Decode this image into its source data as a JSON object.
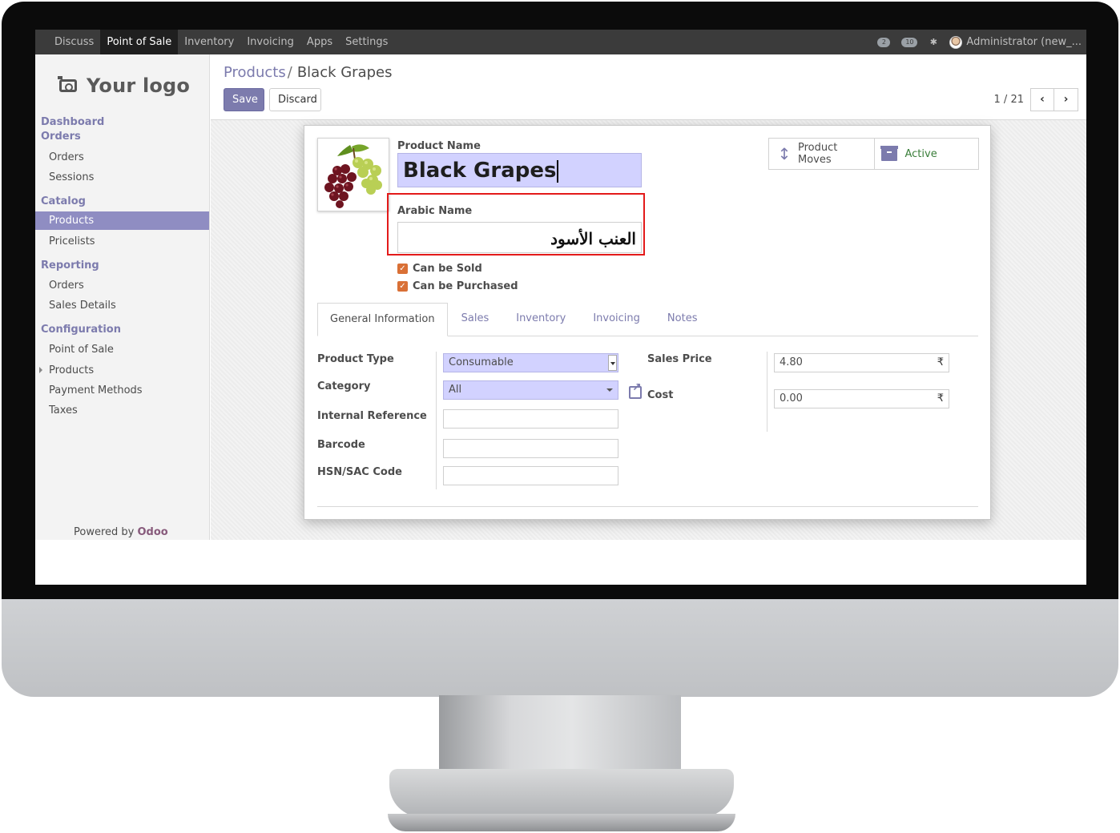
{
  "navbar": {
    "menu": [
      "Discuss",
      "Point of Sale",
      "Inventory",
      "Invoicing",
      "Apps",
      "Settings"
    ],
    "active_menu": "Point of Sale",
    "chat_count": "2",
    "activity_count": "10",
    "user": "Administrator (new_..."
  },
  "sidebar": {
    "logo_text": "Your logo",
    "sections": {
      "dashboard": "Dashboard",
      "orders_heading": "Orders",
      "catalog": "Catalog",
      "reporting": "Reporting",
      "configuration": "Configuration"
    },
    "orders_items": [
      "Orders",
      "Sessions"
    ],
    "catalog_items": [
      "Products",
      "Pricelists"
    ],
    "reporting_items": [
      "Orders",
      "Sales Details"
    ],
    "configuration_items": [
      "Point of Sale",
      "Products",
      "Payment Methods",
      "Taxes"
    ],
    "active_item": "Products",
    "powered_by": "Powered by",
    "powered_brand": "Odoo"
  },
  "control_panel": {
    "breadcrumb_parent": "Products",
    "breadcrumb_separator": "/",
    "breadcrumb_current": "Black Grapes",
    "save_label": "Save",
    "discard_label": "Discard",
    "pager_value": "1 / 21"
  },
  "form": {
    "product_name_label": "Product Name",
    "product_name_value": "Black Grapes",
    "arabic_name_label": "Arabic Name",
    "arabic_name_value": "العنب الأسود",
    "can_be_sold_label": "Can be Sold",
    "can_be_purchased_label": "Can be Purchased",
    "can_be_sold": true,
    "can_be_purchased": true,
    "smart_buttons": {
      "product_moves": "Product\nMoves",
      "active": "Active"
    },
    "tabs": [
      "General Information",
      "Sales",
      "Inventory",
      "Invoicing",
      "Notes"
    ],
    "active_tab": "General Information",
    "fields": {
      "product_type_label": "Product Type",
      "product_type_value": "Consumable",
      "category_label": "Category",
      "category_value": "All",
      "internal_reference_label": "Internal Reference",
      "barcode_label": "Barcode",
      "hsn_label": "HSN/SAC Code",
      "sales_price_label": "Sales Price",
      "sales_price_value": "4.80",
      "cost_label": "Cost",
      "cost_value": "0.00",
      "currency_symbol": "₹"
    }
  },
  "colors": {
    "accent": "#7c7bad",
    "navbar": "#3b3b3b",
    "required_field": "#d2d2ff",
    "checkbox": "#d97036",
    "highlight": "#e31a1a"
  }
}
